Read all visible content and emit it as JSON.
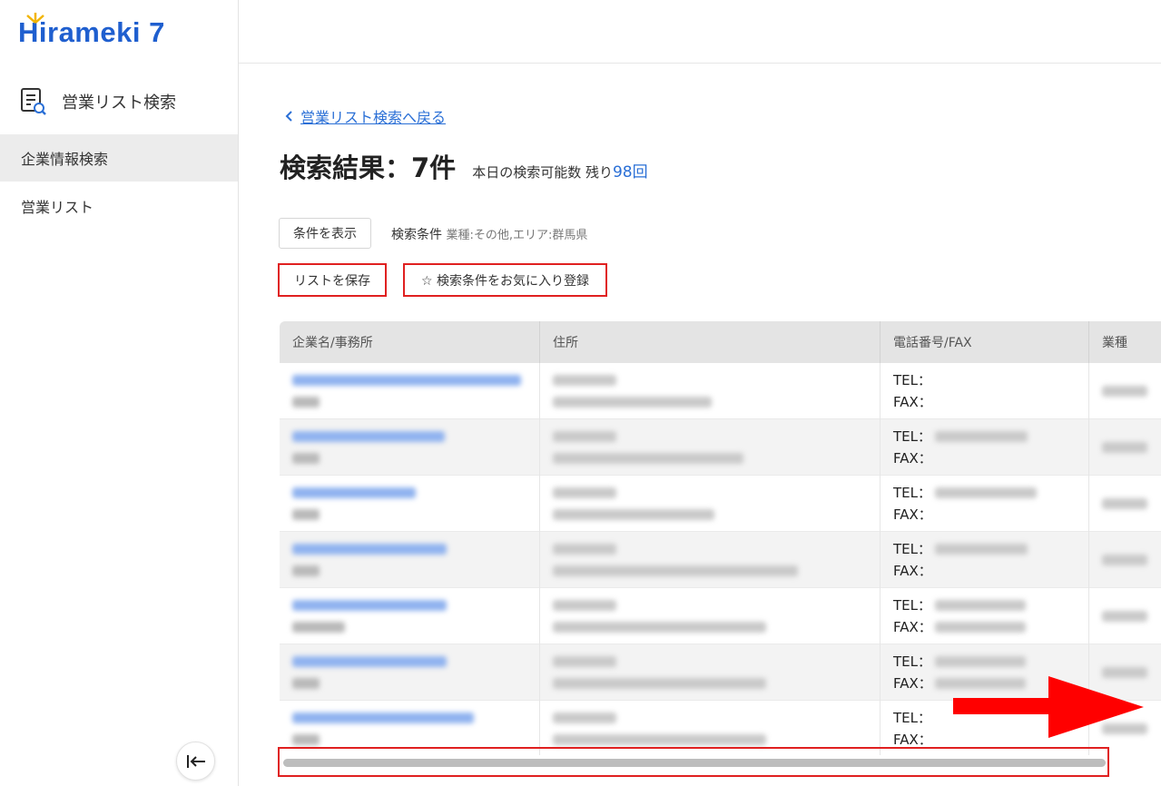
{
  "app": {
    "logo_text": "Hirameki 7",
    "brand_color": "#1f5fcf",
    "accent_color": "#2a6fd6",
    "highlight_color": "#e02020"
  },
  "sidebar": {
    "header_label": "営業リスト検索",
    "header_icon": "search-list-icon",
    "items": [
      {
        "label": "企業情報検索",
        "active": true
      },
      {
        "label": "営業リスト",
        "active": false
      }
    ],
    "collapse_icon": "collapse-left-icon"
  },
  "main": {
    "back_link": "営業リスト検索へ戻る",
    "title": "検索結果：7件",
    "quota_label": "本日の検索可能数 残り",
    "quota_value": "98回",
    "show_conditions_button": "条件を表示",
    "conditions_label": "検索条件",
    "conditions_value": "業種:その他,エリア:群馬県",
    "save_list_button": "リストを保存",
    "favorite_button": "☆ 検索条件をお気に入り登録"
  },
  "table": {
    "columns": [
      "企業名/事務所",
      "住所",
      "電話番号/FAX",
      "業種"
    ],
    "tel_label": "TEL：",
    "fax_label": "FAX：",
    "rows": [
      {
        "has_tel": false,
        "has_fax": false
      },
      {
        "has_tel": true,
        "has_fax": false
      },
      {
        "has_tel": true,
        "has_fax": false
      },
      {
        "has_tel": true,
        "has_fax": false
      },
      {
        "has_tel": true,
        "has_fax": true
      },
      {
        "has_tel": true,
        "has_fax": true
      },
      {
        "has_tel": false,
        "has_fax": false
      }
    ]
  }
}
